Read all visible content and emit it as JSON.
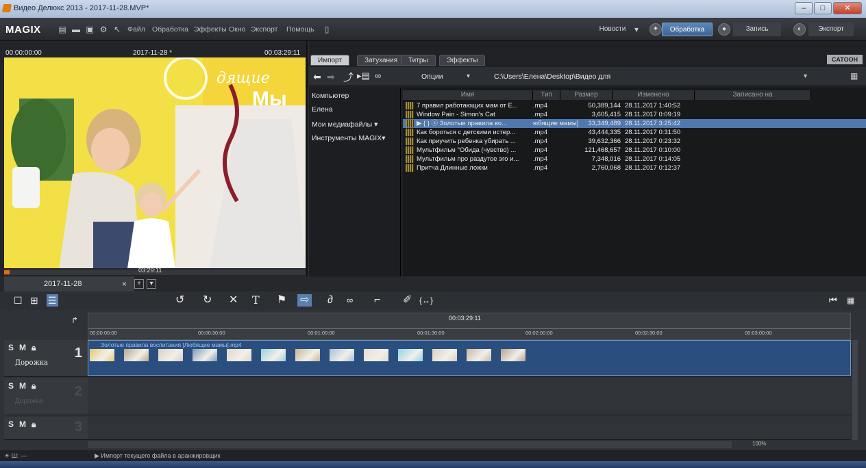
{
  "window": {
    "title": "Видео Делюкс 2013 - 2017-11-28.MVP*",
    "min": "–",
    "max": "□",
    "close": "✕"
  },
  "menubar": {
    "logo": "MAGIX",
    "menus": [
      "Файл",
      "Обработка",
      "Эффекты",
      "Окно",
      "Экспорт",
      "Помощь"
    ],
    "news": "Новости",
    "edit": "Обработка",
    "record": "Запись",
    "export": "Экспорт"
  },
  "preview": {
    "timecode_start": "00:00:00:00",
    "project_name": "2017-11-28 *",
    "timecode_end": "00:03:29:11",
    "position": "03:29:11",
    "overlay_line1": "дящие",
    "overlay_line2": "Мы",
    "transport": [
      "{",
      "}",
      "{◂",
      "⏮",
      "▶",
      "{▸}",
      "▸}",
      "●",
      "▤"
    ]
  },
  "media": {
    "tabs": [
      "Импорт",
      "Затухания",
      "Титры",
      "Эффекты"
    ],
    "active_tab": "Импорт",
    "brand": "CATOOH",
    "options_label": "Опции",
    "path": "C:\\Users\\Елена\\Desktop\\Видео для",
    "nav": [
      "Компьютер",
      "Елена",
      "Мои медиафайлы  ▾",
      "Инструменты MAGIX▾"
    ],
    "columns": [
      "Имя",
      "Тип",
      "Размер",
      "Изменено",
      "Записано на"
    ],
    "files": [
      {
        "name": "7 правил работающих мам от Е...",
        "type": ".mp4",
        "size": "50,389,144",
        "modified": "28.11.2017 1:40:52"
      },
      {
        "name": "Window Pain - Simon's Cat",
        "type": ".mp4",
        "size": "3,605,415",
        "modified": "28.11.2017 0:09:19"
      },
      {
        "name": "▶ { } ⓢ Золотые правила во...",
        "type": "юбящие мамы]",
        "size": "33,349,489",
        "modified": "28.11.2017 3:25:42"
      },
      {
        "name": "Как бороться с детскими истер...",
        "type": ".mp4",
        "size": "43,444,335",
        "modified": "28.11.2017 0:31:50"
      },
      {
        "name": "Как приучить ребенка убирать ...",
        "type": ".mp4",
        "size": "39,632,366",
        "modified": "28.11.2017 0:23:32"
      },
      {
        "name": "Мультфильм \"Обида (чувство) ...",
        "type": ".mp4",
        "size": "121,468,657",
        "modified": "28.11.2017 0:10:00"
      },
      {
        "name": "Мультфильм про раздутое эго и...",
        "type": ".mp4",
        "size": "7,348,016",
        "modified": "28.11.2017 0:14:05"
      },
      {
        "name": "Притча Длинные ложки",
        "type": ".mp4",
        "size": "2,760,068",
        "modified": "28.11.2017 0:12:37"
      }
    ],
    "selected_index": 2
  },
  "timeline": {
    "tab_label": "2017-11-28",
    "close": "×",
    "add": "+",
    "dropdown": "▾",
    "playhead": "00:03:29:11",
    "ticks": [
      "00:00:00:00",
      "00:00:30:00",
      "00:01:00:00",
      "00:01:30:00",
      "00:02:00:00",
      "00:02:30:00",
      "00:03:00:00"
    ],
    "clip_label": "Золотые правила воспитания [Любящие мамы].mp4",
    "tracks": [
      {
        "number": "1",
        "name": "Дорожка"
      },
      {
        "number": "2",
        "name": "Дорожка"
      },
      {
        "number": "3",
        "name": ""
      }
    ],
    "track_buttons": [
      "S",
      "M"
    ],
    "zoom": "100%"
  },
  "status": {
    "left": "☀ Ш:  —",
    "message": "▶ Импорт текущего файла в аранжировщик"
  }
}
